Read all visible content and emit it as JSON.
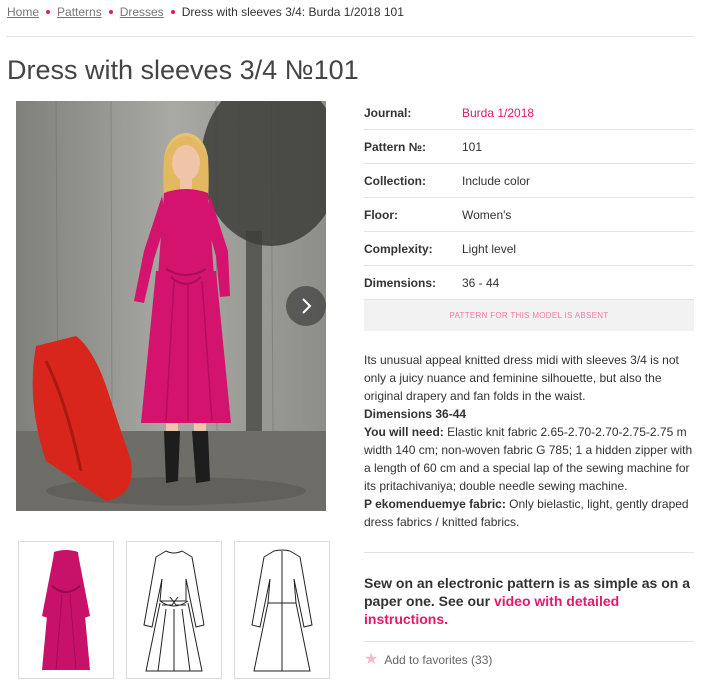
{
  "breadcrumb": {
    "items": [
      "Home",
      "Patterns",
      "Dresses"
    ],
    "current": "Dress with sleeves 3/4: Burda 1/2018 101"
  },
  "page": {
    "title": "Dress with sleeves 3/4 №101"
  },
  "specs": [
    {
      "label": "Journal:",
      "value": "Burda 1/2018",
      "link": true
    },
    {
      "label": "Pattern №:",
      "value": "101",
      "link": false
    },
    {
      "label": "Collection:",
      "value": "Include color",
      "link": false
    },
    {
      "label": "Floor:",
      "value": "Women's",
      "link": false
    },
    {
      "label": "Complexity:",
      "value": "Light level",
      "link": false
    },
    {
      "label": "Dimensions:",
      "value": "36 - 44",
      "link": false
    }
  ],
  "absent_button": "PATTERN FOR THIS MODEL IS ABSENT",
  "description": {
    "intro": "Its unusual appeal knitted dress midi with sleeves 3/4 is not only a juicy nuance and feminine silhouette, but also the original drapery and fan folds in the waist.",
    "dimensions_heading": "Dimensions 36-44",
    "need_label": "You will need:",
    "need_text": " Elastic knit fabric 2.65-2.70-2.70-2.75-2.75 m width 140 cm; non-woven fabric G 785; 1 a hidden zipper with a length of 60 cm and a special lap of the sewing machine for its pritachivaniya; double needle sewing machine.",
    "fabric_label": "P ekomenduemye fabric:",
    "fabric_text": " Only bielastic, light, gently draped dress fabrics / knitted fabrics."
  },
  "cta": {
    "text": "Sew on an electronic pattern is as simple as on a paper one. See our ",
    "link": "video with detailed instructions."
  },
  "favorites": {
    "label": "Add to favorites (33)"
  },
  "colors": {
    "accent": "#e5196b",
    "dress": "#d4136e",
    "coat": "#d8261c"
  },
  "icons": {
    "next": "chevron-right-icon",
    "favorite": "star-icon"
  }
}
